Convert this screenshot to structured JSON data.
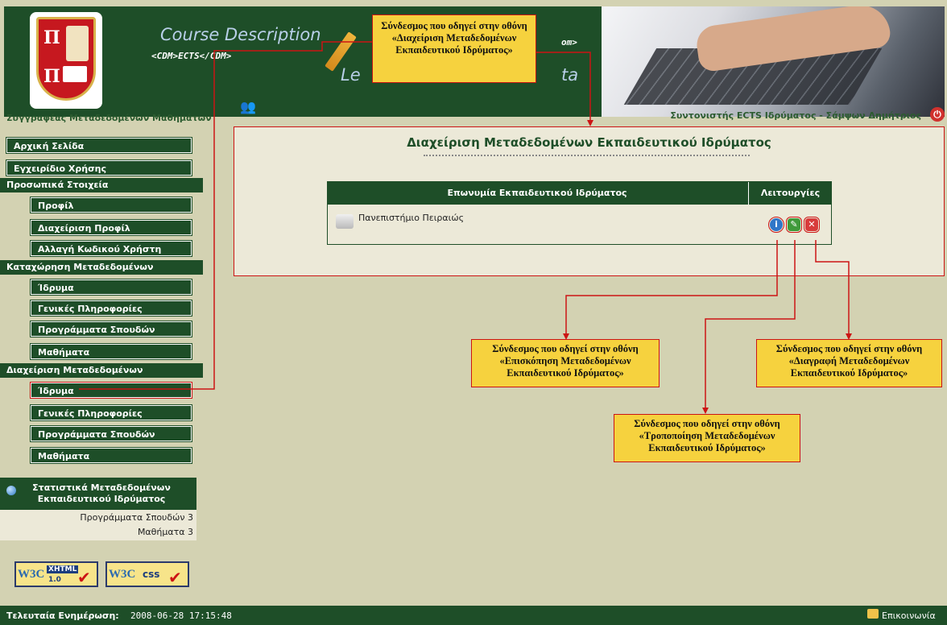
{
  "header": {
    "title": "Course Description",
    "subtitle": "<CDM>ECTS</CDM>",
    "title_part2": "Le",
    "title_part3": "ta",
    "tag_fragment": "om>"
  },
  "user_bar": {
    "role_left": "Συγγραφέας Μεταδεδομένων Μαθημάτων",
    "coordinator": "Συντονιστής ECTS Ιδρύματος - Σάμψων Δημήτριος"
  },
  "sidebar": {
    "home": "Αρχική Σελίδα",
    "manual": "Εγχειρίδιο Χρήσης",
    "personal_section": "Προσωπικά Στοιχεία",
    "profile": "Προφίλ",
    "profile_manage": "Διαχείριση Προφίλ",
    "change_password": "Αλλαγή Κωδικού Χρήστη",
    "entry_section": "Καταχώρηση Μεταδεδομένων",
    "entry_institution": "Ίδρυμα",
    "entry_general": "Γενικές Πληροφορίες",
    "entry_programs": "Προγράμματα Σπουδών",
    "entry_courses": "Μαθήματα",
    "manage_section": "Διαχείριση Μεταδεδομένων",
    "manage_institution": "Ίδρυμα",
    "manage_general": "Γενικές Πληροφορίες",
    "manage_programs": "Προγράμματα Σπουδών",
    "manage_courses": "Μαθήματα"
  },
  "stats": {
    "title_line1": "Στατιστικά Μεταδεδομένων",
    "title_line2": "Εκπαιδευτικού Ιδρύματος",
    "programs": "Προγράμματα Σπουδών 3",
    "courses": "Μαθήματα 3"
  },
  "badges": {
    "xhtml_w3c": "W3C",
    "xhtml_tag": "XHTML",
    "xhtml_ver": "1.0",
    "css_w3c": "W3C",
    "css_tag": "css"
  },
  "main": {
    "page_title": "Διαχείριση Μεταδεδομένων Εκπαιδευτικού Ιδρύματος",
    "table_headers": [
      "Επωνυμία Εκπαιδευτικού Ιδρύματος",
      "Λειτουργίες"
    ],
    "institution": "Πανεπιστήμιο Πειραιώς",
    "op_view": "i",
    "op_edit": "✎",
    "op_delete": "✕"
  },
  "callouts": {
    "top_line1": "Σύνδεσμος που οδηγεί στην οθόνη",
    "top_line2": "«Διαχείριση Μεταδεδομένων",
    "top_line3": "Εκπαιδευτικού Ιδρύματος»",
    "view_line1": "Σύνδεσμος που οδηγεί στην οθόνη",
    "view_line2": "«Επισκόπηση Μεταδεδομένων",
    "view_line3": "Εκπαιδευτικού Ιδρύματος»",
    "edit_line1": "Σύνδεσμος που οδηγεί στην οθόνη",
    "edit_line2": "«Τροποποίηση Μεταδεδομένων",
    "edit_line3": "Εκπαιδευτικού Ιδρύματος»",
    "delete_line1": "Σύνδεσμος που οδηγεί στην οθόνη",
    "delete_line2": "«Διαγραφή Μεταδεδομένων",
    "delete_line3": "Εκπαιδευτικού Ιδρύματος»"
  },
  "footer": {
    "last_update_label": "Τελευταία Ενημέρωση:",
    "last_update_value": "2008-06-28 17:15:48",
    "contact": "Επικοινωνία"
  },
  "colors": {
    "dark_green": "#1e4e28",
    "background": "#d3d2b2",
    "panel": "#ece9d8",
    "callout": "#f6d23e",
    "annotation_red": "#cc1414"
  }
}
